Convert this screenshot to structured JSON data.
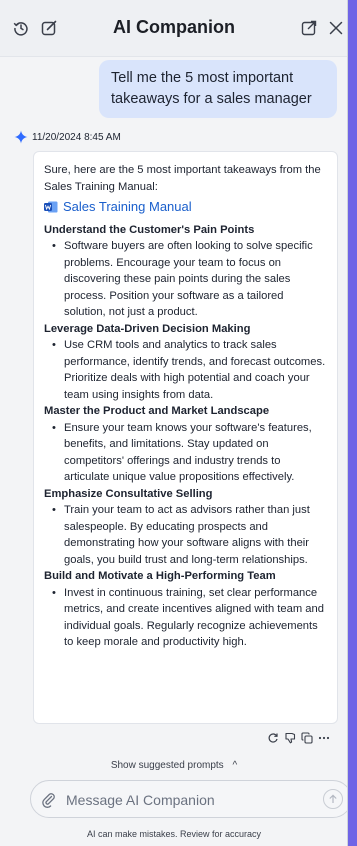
{
  "header": {
    "title": "AI Companion"
  },
  "user_message": "Tell me the 5 most important takeaways for a sales manager",
  "response": {
    "timestamp": "11/20/2024 8:45 AM",
    "intro": "Sure, here are the 5 most important takeaways from the Sales Training Manual:",
    "document_link": "Sales Training Manual",
    "bullet": "•",
    "sections": [
      {
        "title": "Understand the Customer's Pain Points",
        "body": "Software buyers are often looking to solve specific problems. Encourage your team to focus on discovering these pain points during the sales process. Position your software as a tailored solution, not just a product."
      },
      {
        "title": "Leverage Data-Driven Decision Making",
        "body": "Use CRM tools and analytics to track sales performance, identify trends, and forecast outcomes. Prioritize deals with high potential and coach your team using insights from data."
      },
      {
        "title": "Master the Product and Market Landscape",
        "body": "Ensure your team knows your software's features, benefits, and limitations. Stay updated on competitors' offerings and industry trends to articulate unique value propositions effectively."
      },
      {
        "title": "Emphasize Consultative Selling",
        "body": "Train your team to act as advisors rather than just salespeople. By educating prospects and demonstrating how your software aligns with their goals, you build trust and long-term relationships."
      },
      {
        "title": "Build and Motivate a High-Performing Team",
        "body": "Invest in continuous training, set clear performance metrics, and create incentives aligned with team and individual goals. Regularly recognize achievements to keep morale and productivity high."
      }
    ]
  },
  "suggested_prompts": {
    "label": "Show suggested prompts",
    "chevron": "^"
  },
  "composer": {
    "placeholder": "Message AI Companion"
  },
  "disclaimer": "AI can make mistakes. Review for accuracy",
  "icons": {
    "history": "history-icon",
    "new_chat": "compose-icon",
    "pop_out": "pop-out-icon",
    "close": "close-icon",
    "ai": "sparkle-icon",
    "doc": "word-document-icon",
    "regenerate": "refresh-icon",
    "dislike": "thumbs-down-icon",
    "copy": "copy-icon",
    "more": "more-icon",
    "attach": "paperclip-icon",
    "send": "arrow-up-icon"
  },
  "colors": {
    "background_accent": "#6f64e6",
    "panel": "#f3f4f6",
    "user_bubble": "#d9e4fb",
    "link": "#1a5fcc",
    "ai_spark": "#2f6bff"
  }
}
